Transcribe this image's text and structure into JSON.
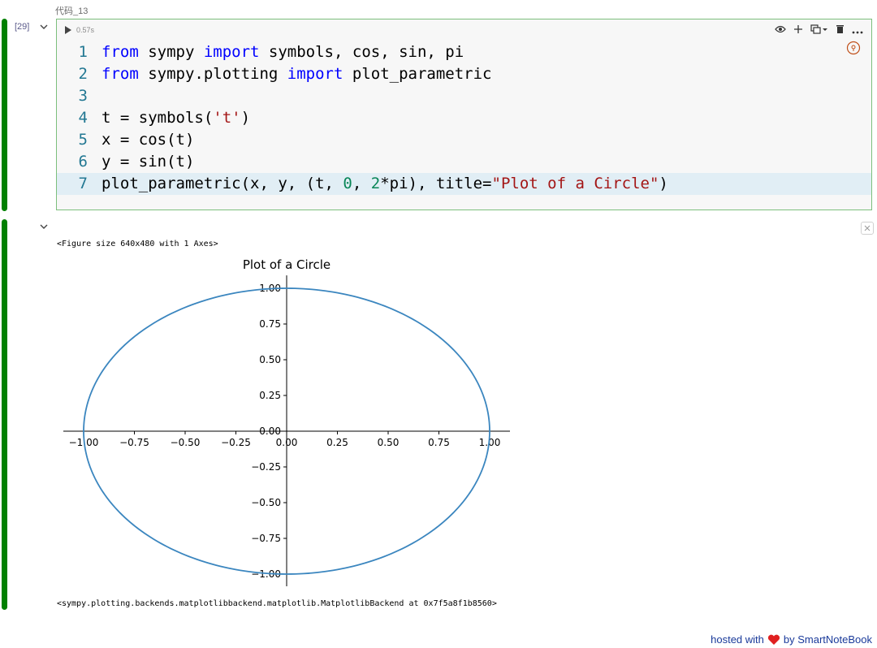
{
  "cell": {
    "label": "代码_13",
    "exec_count": "[29]",
    "run_time": "0.57s",
    "code_lines": [
      [
        {
          "t": "from",
          "c": "kw"
        },
        {
          "t": " sympy ",
          "c": "tx"
        },
        {
          "t": "import",
          "c": "kw"
        },
        {
          "t": " symbols, cos, sin, pi",
          "c": "tx"
        }
      ],
      [
        {
          "t": "from",
          "c": "kw"
        },
        {
          "t": " sympy.plotting ",
          "c": "tx"
        },
        {
          "t": "import",
          "c": "kw"
        },
        {
          "t": " plot_parametric",
          "c": "tx"
        }
      ],
      [],
      [
        {
          "t": "t = symbols(",
          "c": "tx"
        },
        {
          "t": "'t'",
          "c": "str"
        },
        {
          "t": ")",
          "c": "tx"
        }
      ],
      [
        {
          "t": "x = cos(t)",
          "c": "tx"
        }
      ],
      [
        {
          "t": "y = sin(t)",
          "c": "tx"
        }
      ],
      [
        {
          "t": "plot_parametric(x, y, (t, ",
          "c": "tx"
        },
        {
          "t": "0",
          "c": "num"
        },
        {
          "t": ", ",
          "c": "tx"
        },
        {
          "t": "2",
          "c": "num"
        },
        {
          "t": "*pi), title=",
          "c": "tx"
        },
        {
          "t": "\"Plot of a Circle\"",
          "c": "str"
        },
        {
          "t": ")",
          "c": "tx"
        }
      ]
    ],
    "toolbar_icons": [
      "eye-icon",
      "plus-icon",
      "split-cell-icon",
      "trash-icon",
      "more-icon"
    ]
  },
  "output": {
    "figure_text": "<Figure size 640x480 with 1 Axes>",
    "backend_text": "<sympy.plotting.backends.matplotlibbackend.matplotlib.MatplotlibBackend at 0x7f5a8f1b8560>"
  },
  "footer": {
    "hosted": "hosted with",
    "by": "by SmartNoteBook"
  },
  "colors": {
    "curve": "#3b86bf",
    "green_bar": "#008000"
  },
  "chart_data": {
    "type": "line",
    "title": "Plot of a Circle",
    "xlabel": "",
    "ylabel": "",
    "xlim": [
      -1.0,
      1.0
    ],
    "ylim": [
      -1.0,
      1.0
    ],
    "x_ticks": [
      "−1.00",
      "−0.75",
      "−0.50",
      "−0.25",
      "0.00",
      "0.25",
      "0.50",
      "0.75",
      "1.00"
    ],
    "x_tick_values": [
      -1.0,
      -0.75,
      -0.5,
      -0.25,
      0.0,
      0.25,
      0.5,
      0.75,
      1.0
    ],
    "y_ticks": [
      "1.00",
      "0.75",
      "0.50",
      "0.25",
      "0.00",
      "−0.25",
      "−0.50",
      "−0.75",
      "−1.00"
    ],
    "y_tick_values": [
      1.0,
      0.75,
      0.5,
      0.25,
      0.0,
      -0.25,
      -0.5,
      -0.75,
      -1.0
    ],
    "series": [
      {
        "parametric": "x = cos(t), y = sin(t)",
        "t_range": [
          0,
          6.283185
        ]
      }
    ],
    "spines": "centered"
  }
}
